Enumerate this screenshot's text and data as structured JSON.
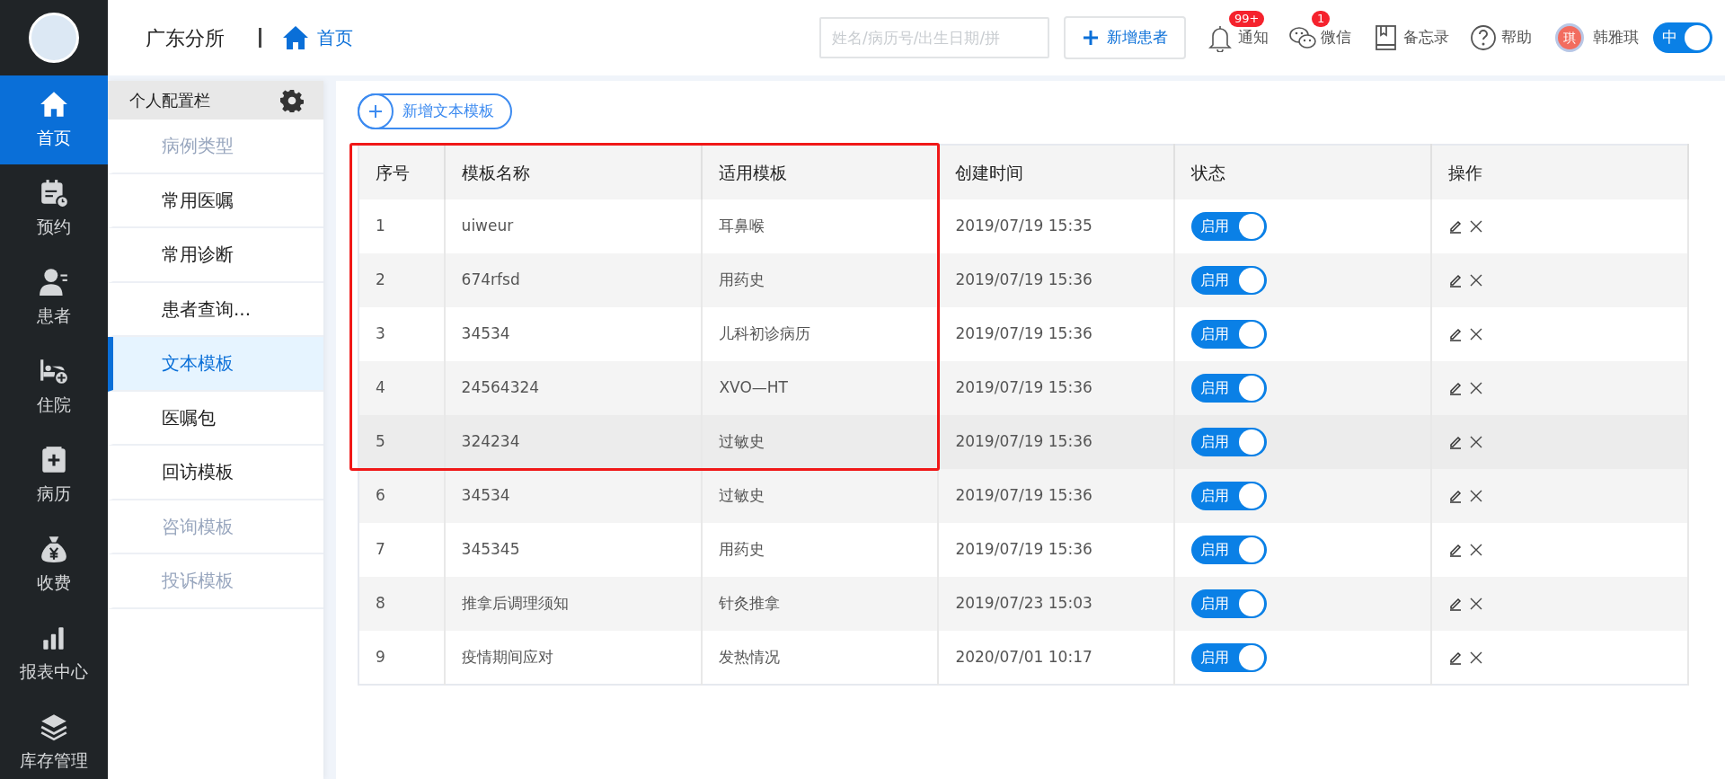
{
  "rail": {
    "items": [
      {
        "label": "首页",
        "kind": "home",
        "selected": true
      },
      {
        "label": "预约",
        "kind": "calendar",
        "selected": false
      },
      {
        "label": "患者",
        "kind": "person",
        "selected": false
      },
      {
        "label": "住院",
        "kind": "bed",
        "selected": false
      },
      {
        "label": "病历",
        "kind": "record",
        "selected": false
      },
      {
        "label": "收费",
        "kind": "money",
        "selected": false
      },
      {
        "label": "报表中心",
        "kind": "bars",
        "selected": false
      },
      {
        "label": "库存管理",
        "kind": "layers",
        "selected": false
      }
    ]
  },
  "header": {
    "branch": "广东分所",
    "breadcrumb": "首页",
    "search": {
      "placeholder": "姓名/病历号/出生日期/拼"
    },
    "add_button": "新增患者",
    "tools": [
      {
        "label": "通知",
        "kind": "bell",
        "badge": "99+"
      },
      {
        "label": "微信",
        "kind": "chat",
        "badge": "1"
      },
      {
        "label": "备忘录",
        "kind": "book"
      },
      {
        "label": "帮助",
        "kind": "help"
      }
    ],
    "user": {
      "avatar": "琪",
      "name": "韩雅琪"
    },
    "lang_toggle": {
      "label": "中",
      "on": true
    }
  },
  "config_panel": {
    "title": "个人配置栏",
    "items": [
      {
        "label": "病例类型",
        "disabled": true,
        "selected": false
      },
      {
        "label": "常用医嘱",
        "disabled": false,
        "selected": false
      },
      {
        "label": "常用诊断",
        "disabled": false,
        "selected": false
      },
      {
        "label": "患者查询...",
        "disabled": false,
        "selected": false
      },
      {
        "label": "文本模板",
        "disabled": false,
        "selected": true
      },
      {
        "label": "医嘱包",
        "disabled": false,
        "selected": false
      },
      {
        "label": "回访模板",
        "disabled": false,
        "selected": false
      },
      {
        "label": "咨询模板",
        "disabled": true,
        "selected": false
      },
      {
        "label": "投诉模板",
        "disabled": true,
        "selected": false
      }
    ]
  },
  "add_template_button": "新增文本模板",
  "table": {
    "columns": [
      "序号",
      "模板名称",
      "适用模板",
      "创建时间",
      "状态",
      "操作"
    ],
    "rows": [
      {
        "no": "1",
        "name": "uiweur",
        "template": "耳鼻喉",
        "created": "2019/07/19 15:35",
        "status": {
          "label": "启用",
          "on": true
        },
        "hovered": false,
        "framed": true
      },
      {
        "no": "2",
        "name": "674rfsd",
        "template": "用药史",
        "created": "2019/07/19 15:36",
        "status": {
          "label": "启用",
          "on": true
        },
        "hovered": false,
        "framed": true
      },
      {
        "no": "3",
        "name": "34534",
        "template": "儿科初诊病历",
        "created": "2019/07/19 15:36",
        "status": {
          "label": "启用",
          "on": true
        },
        "hovered": false,
        "framed": true
      },
      {
        "no": "4",
        "name": "24564324",
        "template": "XVO—HT",
        "created": "2019/07/19 15:36",
        "status": {
          "label": "启用",
          "on": true
        },
        "hovered": false,
        "framed": true
      },
      {
        "no": "5",
        "name": "324234",
        "template": "过敏史",
        "created": "2019/07/19 15:36",
        "status": {
          "label": "启用",
          "on": true
        },
        "hovered": true,
        "framed": true
      },
      {
        "no": "6",
        "name": "34534",
        "template": "过敏史",
        "created": "2019/07/19 15:36",
        "status": {
          "label": "启用",
          "on": true
        },
        "hovered": false,
        "framed": false
      },
      {
        "no": "7",
        "name": "345345",
        "template": "用药史",
        "created": "2019/07/19 15:36",
        "status": {
          "label": "启用",
          "on": true
        },
        "hovered": false,
        "framed": false
      },
      {
        "no": "8",
        "name": "推拿后调理须知",
        "template": "针灸推拿",
        "created": "2019/07/23 15:03",
        "status": {
          "label": "启用",
          "on": true
        },
        "hovered": false,
        "framed": false
      },
      {
        "no": "9",
        "name": "疫情期间应对",
        "template": "发热情况",
        "created": "2020/07/01 10:17",
        "status": {
          "label": "启用",
          "on": true
        },
        "hovered": false,
        "framed": false
      }
    ]
  }
}
